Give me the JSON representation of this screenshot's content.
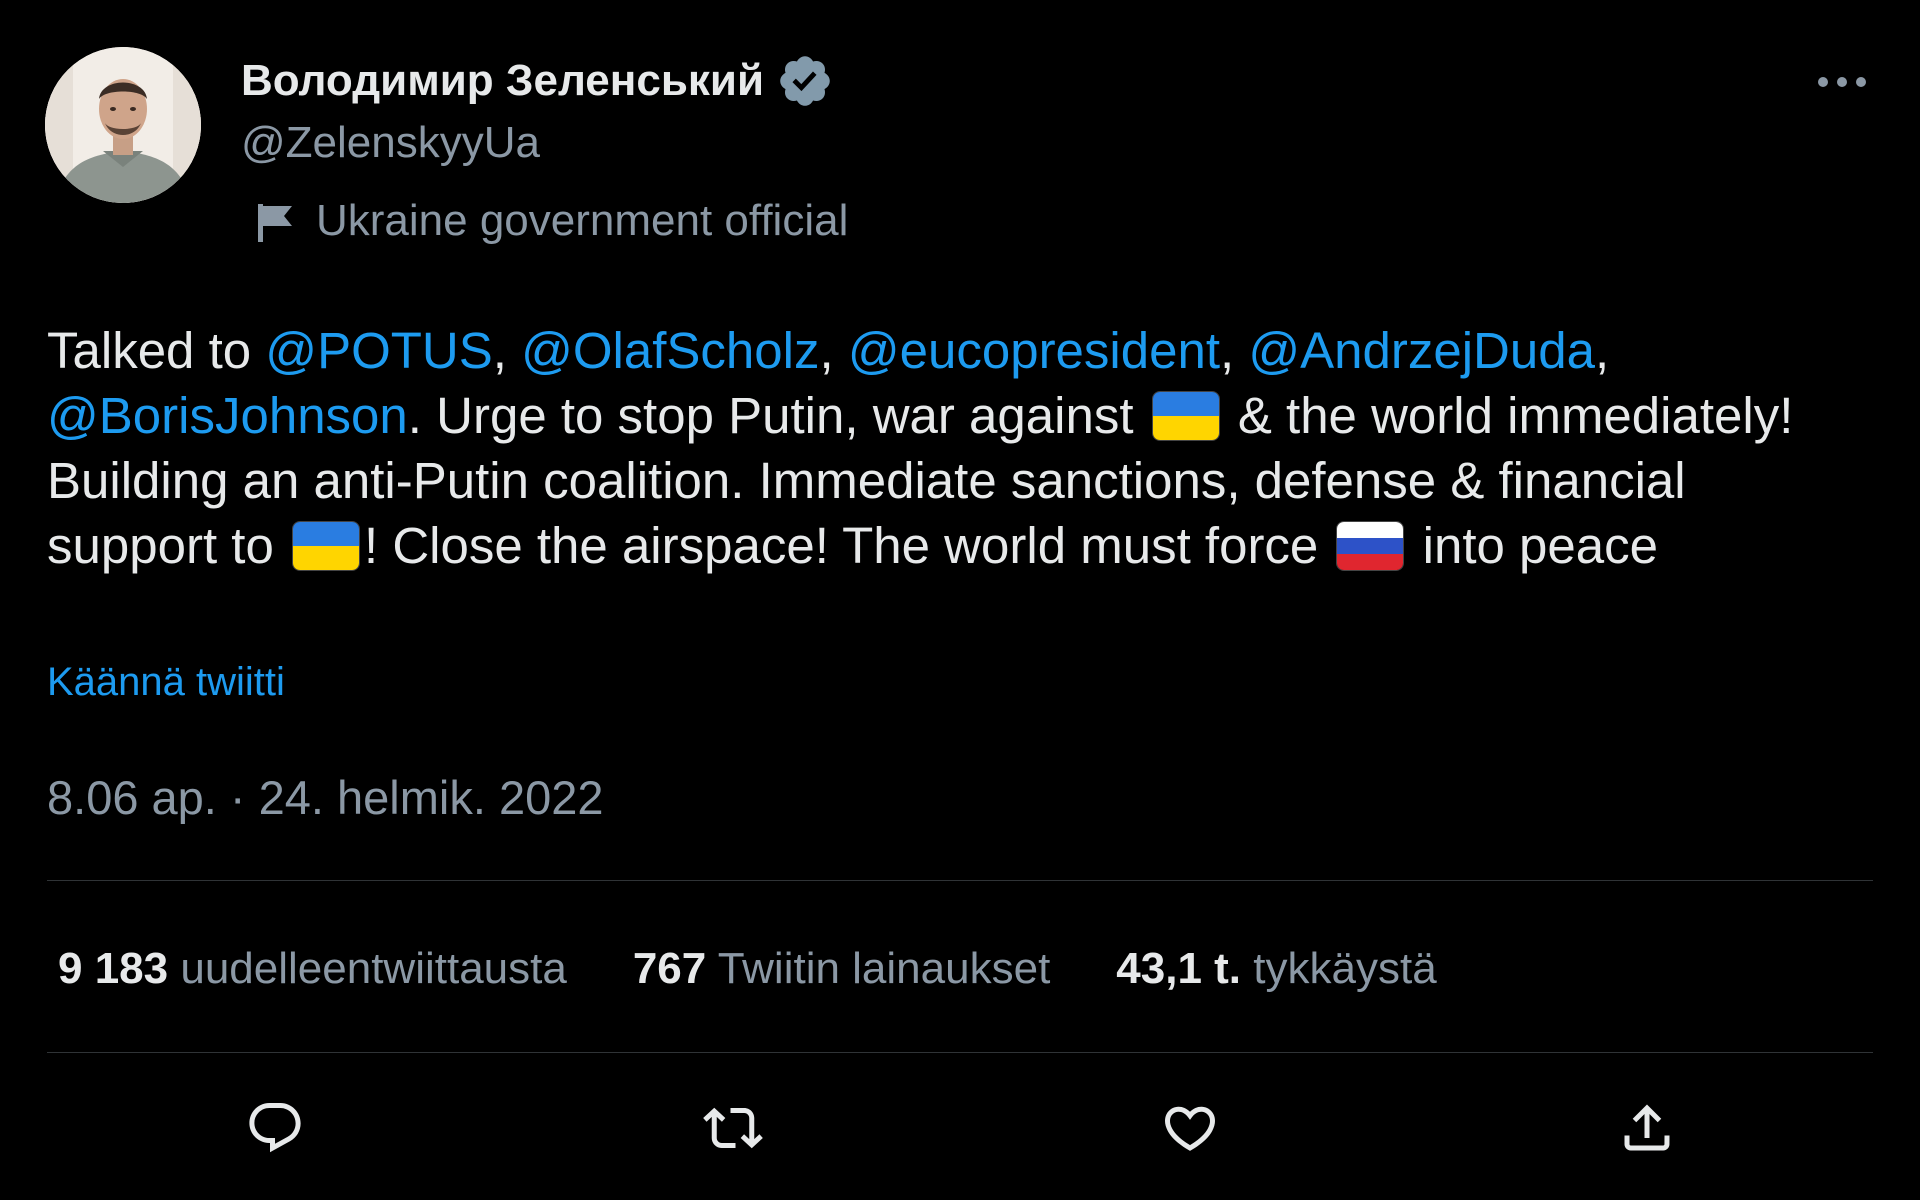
{
  "author": {
    "display_name": "Володимир Зеленський",
    "handle": "@ZelenskyyUa",
    "affiliation": "Ukraine government official",
    "verified_badge_color": "#829aab"
  },
  "tweet": {
    "segments": {
      "t1": "Talked to ",
      "m1": "@POTUS",
      "t2": ", ",
      "m2": "@OlafScholz",
      "t3": ", ",
      "m3": "@eucopresident",
      "t4": ", ",
      "m4": "@AndrzejDuda",
      "t5": ",",
      "m5": "@BorisJohnson",
      "t6": ". Urge to stop Putin, war against ",
      "t7": " & the world immediately! Building an anti-Putin coalition. Immediate sanctions, defense & financial support to ",
      "t8": "! Close the airspace! The world must force ",
      "t9": " into peace"
    },
    "flags": [
      "ukraine-flag",
      "ukraine-flag",
      "russia-flag"
    ],
    "translate_label": "Käännä twiitti",
    "timestamp": "8.06 ap. · 24. helmik. 2022"
  },
  "stats": {
    "retweets_count": "9 183",
    "retweets_label": "uudelleentwiittausta",
    "quotes_count": "767",
    "quotes_label": "Twiitin lainaukset",
    "likes_count": "43,1 t.",
    "likes_label": "tykkäystä"
  },
  "actions": [
    "reply-icon",
    "retweet-icon",
    "like-icon",
    "share-icon"
  ],
  "colors": {
    "background": "#000000",
    "text": "#e7e9ea",
    "secondary": "#8b98a5",
    "link": "#1d9bf0",
    "divider": "#2f3336"
  }
}
